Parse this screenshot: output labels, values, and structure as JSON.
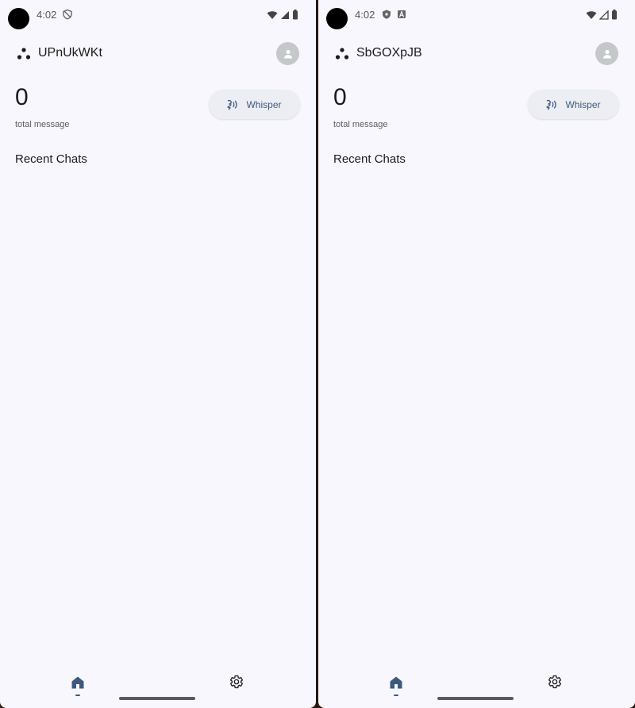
{
  "panes": [
    {
      "status": {
        "time": "4:02",
        "notif_icons": [
          "shield-outline-icon"
        ]
      },
      "app_bar": {
        "title": "UPnUkWKt"
      },
      "stats": {
        "count": "0",
        "label": "total message"
      },
      "whisper": {
        "label": "Whisper"
      },
      "section": {
        "title": "Recent Chats"
      }
    },
    {
      "status": {
        "time": "4:02",
        "notif_icons": [
          "shield-filled-icon",
          "a-badge-icon"
        ]
      },
      "app_bar": {
        "title": "SbGOXpJB"
      },
      "stats": {
        "count": "0",
        "label": "total message"
      },
      "whisper": {
        "label": "Whisper"
      },
      "section": {
        "title": "Recent Chats"
      }
    }
  ],
  "colors": {
    "background": "#f8f7fd",
    "accent": "#3c5a80",
    "button_bg": "#eceef4",
    "avatar": "#c4c8cb"
  }
}
